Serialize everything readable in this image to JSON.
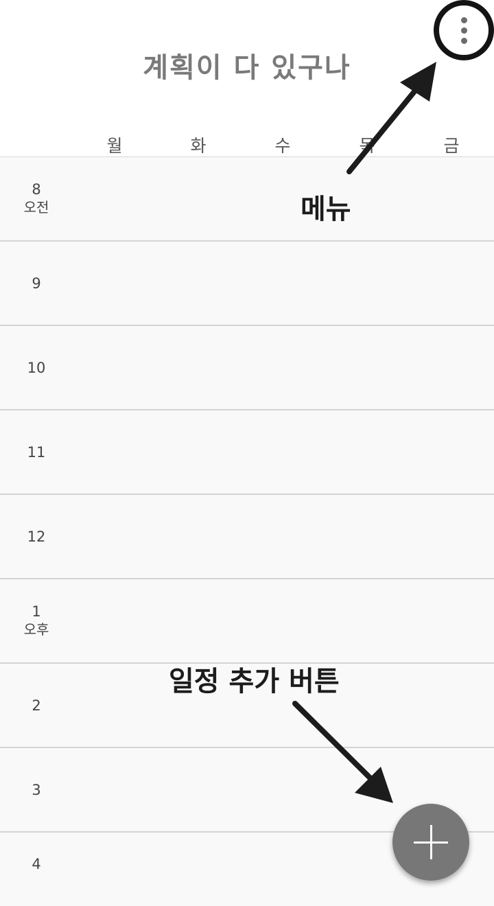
{
  "header": {
    "title": "계획이 다 있구나",
    "menu_icon": "more-vert-icon"
  },
  "weekdays": [
    "월",
    "화",
    "수",
    "목",
    "금"
  ],
  "timetable": {
    "rows": [
      {
        "hour": "8",
        "meridiem": "오전"
      },
      {
        "hour": "9",
        "meridiem": ""
      },
      {
        "hour": "10",
        "meridiem": ""
      },
      {
        "hour": "11",
        "meridiem": ""
      },
      {
        "hour": "12",
        "meridiem": ""
      },
      {
        "hour": "1",
        "meridiem": "오후"
      },
      {
        "hour": "2",
        "meridiem": ""
      },
      {
        "hour": "3",
        "meridiem": ""
      },
      {
        "hour": "4",
        "meridiem": ""
      }
    ]
  },
  "annotations": {
    "menu_label": "메뉴",
    "add_label": "일정 추가 버튼"
  },
  "fab": {
    "icon": "plus-icon",
    "color": "#777777"
  }
}
